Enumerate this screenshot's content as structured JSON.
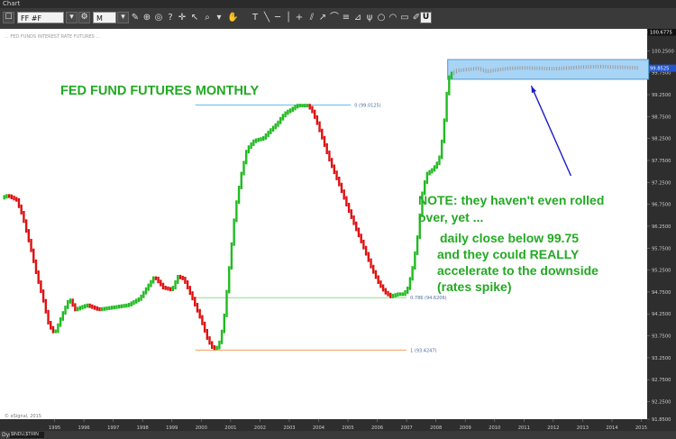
{
  "window": {
    "title": "Chart"
  },
  "toolbar": {
    "symbol": "FF #F",
    "interval": "M"
  },
  "chart_header": "... FED FUNDS INTEREST RATE FUTURES ...",
  "copyright": "© eSignal, 2015",
  "footer": {
    "label": "Dyn",
    "field": "$INDU,$TRIN"
  },
  "annotations": {
    "title": "FED FUND FUTURES MONTHLY",
    "note_line1": "NOTE: they haven't even rolled",
    "note_line2": "over, yet ...",
    "body_line1": "daily close below 99.75",
    "body_line2": "and they could REALLY",
    "body_line3": "accelerate to the downside",
    "body_line4": "(rates spike)"
  },
  "fib": {
    "top": "0 (99.0125)",
    "mid": "0.786 (94.6206)",
    "bottom": "1 (93.4247)"
  },
  "colors": {
    "up": "#22bb22",
    "down": "#dd1111",
    "green_text": "#22aa22",
    "blue_arrow": "#1a1acc",
    "box_fill": "#a8d4f5",
    "box_border": "#5599cc"
  },
  "chart_data": {
    "type": "bar",
    "ylim": [
      91.85,
      100.75
    ],
    "current_price": "100.6775",
    "y_ticks": [
      "100.6793",
      "100.2500",
      "99.7500",
      "99.2500",
      "98.7500",
      "98.2500",
      "97.7500",
      "97.2500",
      "96.7500",
      "96.2500",
      "95.7500",
      "95.2500",
      "94.7500",
      "94.2500",
      "93.7500",
      "93.2500",
      "92.7500",
      "92.2500",
      "91.8500"
    ],
    "last_price_label": "99.8525",
    "x_ticks": [
      "1995",
      "1996",
      "1997",
      "1998",
      "1999",
      "2000",
      "2001",
      "2002",
      "2003",
      "2004",
      "2005",
      "2006",
      "2007",
      "2008",
      "2009",
      "2010",
      "2011",
      "2012",
      "2013",
      "2014",
      "2015"
    ],
    "x_range": [
      1993.7,
      2015.7
    ],
    "path": [
      [
        1993.7,
        96.9
      ],
      [
        1993.9,
        96.95
      ],
      [
        1994.2,
        96.85
      ],
      [
        1994.4,
        96.5
      ],
      [
        1994.7,
        95.7
      ],
      [
        1994.9,
        95.1
      ],
      [
        1995.1,
        94.6
      ],
      [
        1995.3,
        94.0
      ],
      [
        1995.5,
        93.8
      ],
      [
        1995.8,
        94.3
      ],
      [
        1996.0,
        94.6
      ],
      [
        1996.2,
        94.35
      ],
      [
        1996.6,
        94.45
      ],
      [
        1997.0,
        94.35
      ],
      [
        1997.5,
        94.4
      ],
      [
        1998.0,
        94.45
      ],
      [
        1998.4,
        94.6
      ],
      [
        1998.7,
        94.9
      ],
      [
        1998.9,
        95.1
      ],
      [
        1999.2,
        94.85
      ],
      [
        1999.5,
        94.8
      ],
      [
        1999.7,
        95.1
      ],
      [
        1999.9,
        95.05
      ],
      [
        2000.2,
        94.6
      ],
      [
        2000.5,
        94.1
      ],
      [
        2000.7,
        93.7
      ],
      [
        2000.85,
        93.5
      ],
      [
        2001.0,
        93.45
      ],
      [
        2001.1,
        93.55
      ],
      [
        2001.25,
        94.0
      ],
      [
        2001.45,
        95.3
      ],
      [
        2001.65,
        96.6
      ],
      [
        2001.85,
        97.4
      ],
      [
        2002.05,
        98.0
      ],
      [
        2002.3,
        98.2
      ],
      [
        2002.6,
        98.25
      ],
      [
        2002.8,
        98.4
      ],
      [
        2002.95,
        98.5
      ],
      [
        2003.1,
        98.6
      ],
      [
        2003.25,
        98.75
      ],
      [
        2003.4,
        98.85
      ],
      [
        2003.55,
        98.9
      ],
      [
        2003.75,
        99.0
      ],
      [
        2003.95,
        99.0
      ],
      [
        2004.15,
        99.0
      ],
      [
        2004.3,
        98.85
      ],
      [
        2004.45,
        98.6
      ],
      [
        2004.65,
        98.2
      ],
      [
        2004.9,
        97.7
      ],
      [
        2005.2,
        97.2
      ],
      [
        2005.5,
        96.65
      ],
      [
        2005.8,
        96.15
      ],
      [
        2006.1,
        95.65
      ],
      [
        2006.3,
        95.3
      ],
      [
        2006.55,
        94.95
      ],
      [
        2006.75,
        94.75
      ],
      [
        2006.95,
        94.65
      ],
      [
        2007.2,
        94.7
      ],
      [
        2007.4,
        94.7
      ],
      [
        2007.55,
        94.85
      ],
      [
        2007.7,
        95.3
      ],
      [
        2007.85,
        95.9
      ],
      [
        2007.95,
        96.5
      ],
      [
        2008.05,
        97.1
      ],
      [
        2008.2,
        97.45
      ],
      [
        2008.4,
        97.55
      ],
      [
        2008.6,
        97.75
      ],
      [
        2008.75,
        98.4
      ],
      [
        2008.85,
        99.2
      ],
      [
        2008.95,
        99.65
      ],
      [
        2009.05,
        99.75
      ],
      [
        2009.2,
        99.8
      ],
      [
        2009.5,
        99.82
      ],
      [
        2009.9,
        99.85
      ],
      [
        2010.2,
        99.78
      ],
      [
        2010.6,
        99.82
      ],
      [
        2011.0,
        99.85
      ],
      [
        2011.5,
        99.86
      ],
      [
        2012.0,
        99.85
      ],
      [
        2012.5,
        99.84
      ],
      [
        2013.0,
        99.86
      ],
      [
        2013.5,
        99.88
      ],
      [
        2014.0,
        99.89
      ],
      [
        2014.5,
        99.88
      ],
      [
        2015.0,
        99.87
      ],
      [
        2015.4,
        99.86
      ]
    ],
    "fib_levels": [
      {
        "label": "0 (99.0125)",
        "value": 99.0125,
        "from": 2000.3,
        "to": 2005.6,
        "color": "#66bbee"
      },
      {
        "label": "0.786 (94.6206)",
        "value": 94.6206,
        "from": 2000.3,
        "to": 2007.5,
        "color": "#88dd88"
      },
      {
        "label": "1 (93.4247)",
        "value": 93.4247,
        "from": 2000.3,
        "to": 2007.5,
        "color": "#f0a060"
      }
    ],
    "highlight_box": {
      "x": [
        2008.9,
        2015.75
      ],
      "y": [
        99.6,
        100.05
      ]
    },
    "arrow": {
      "from": [
        2013.1,
        97.4
      ],
      "to": [
        2011.75,
        99.45
      ]
    }
  }
}
